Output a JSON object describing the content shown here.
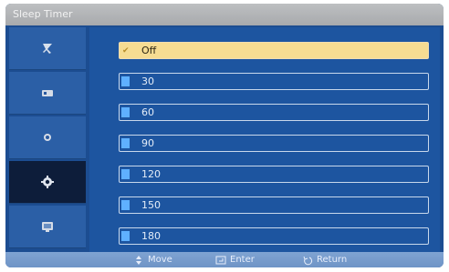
{
  "window": {
    "title": "Sleep Timer"
  },
  "sidebar": {
    "items": [
      {
        "icon": "picture-icon"
      },
      {
        "icon": "sound-icon"
      },
      {
        "icon": "channel-icon"
      },
      {
        "icon": "setup-gear-icon",
        "active": true
      },
      {
        "icon": "input-icon"
      }
    ]
  },
  "options": [
    {
      "label": "Off",
      "selected": true
    },
    {
      "label": "30",
      "selected": false
    },
    {
      "label": "60",
      "selected": false
    },
    {
      "label": "90",
      "selected": false
    },
    {
      "label": "120",
      "selected": false
    },
    {
      "label": "150",
      "selected": false
    },
    {
      "label": "180",
      "selected": false
    }
  ],
  "footer": {
    "move": "Move",
    "enter": "Enter",
    "return": "Return"
  },
  "colors": {
    "panel": "#1d55a0",
    "highlight": "#f6dc92",
    "marker": "#5fb0ff",
    "active_nav": "#0d1d3a"
  }
}
